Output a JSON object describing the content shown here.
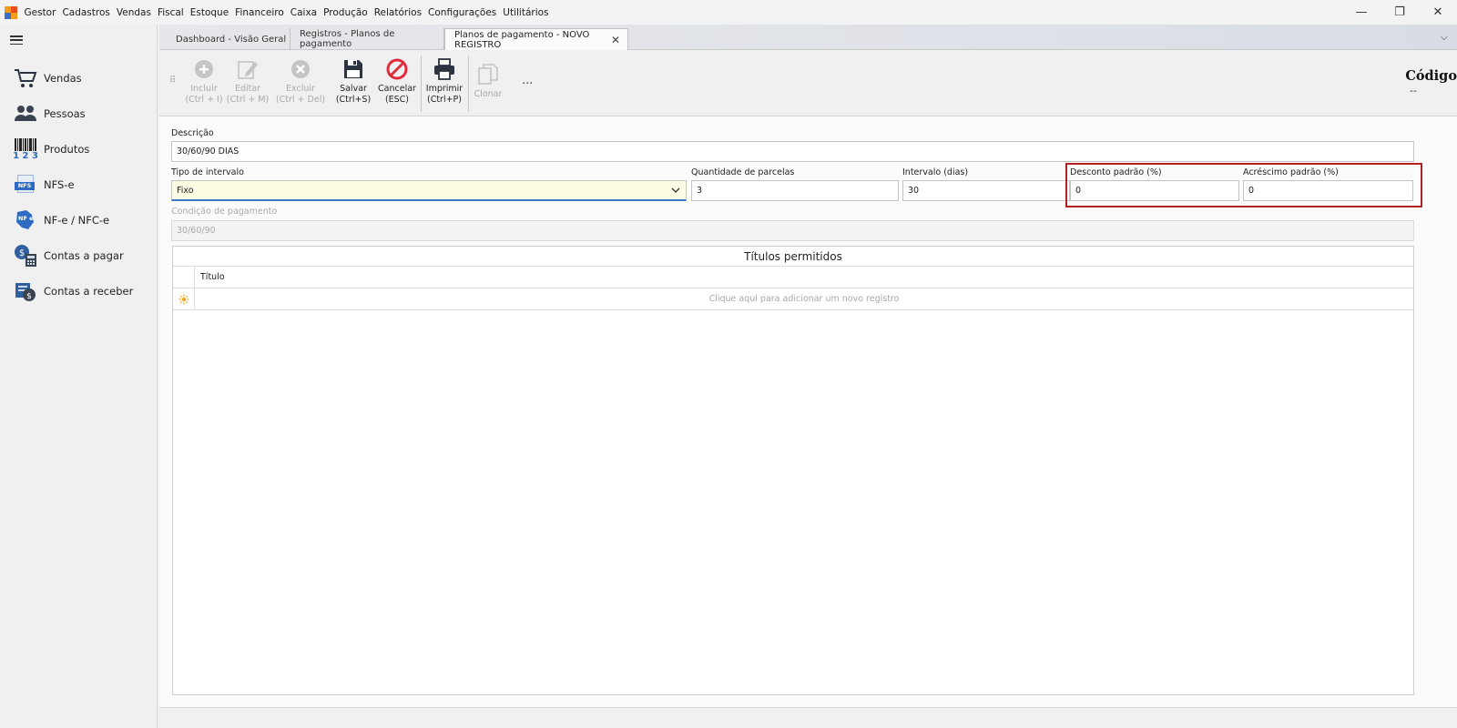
{
  "menu": {
    "items": [
      "Gestor",
      "Cadastros",
      "Vendas",
      "Fiscal",
      "Estoque",
      "Financeiro",
      "Caixa",
      "Produção",
      "Relatórios",
      "Configurações",
      "Utilitários"
    ]
  },
  "window_controls": {
    "minimize": "—",
    "restore": "❐",
    "close": "✕"
  },
  "sidebar": {
    "items": [
      {
        "label": "Vendas",
        "icon": "cart-icon"
      },
      {
        "label": "Pessoas",
        "icon": "people-icon"
      },
      {
        "label": "Produtos",
        "icon": "barcode-icon"
      },
      {
        "label": "NFS-e",
        "icon": "nfse-icon"
      },
      {
        "label": "NF-e / NFC-e",
        "icon": "nfe-icon"
      },
      {
        "label": "Contas a pagar",
        "icon": "payable-icon"
      },
      {
        "label": "Contas a receber",
        "icon": "receivable-icon"
      }
    ],
    "nfse_badge": "NFS",
    "nfe_badge": "NF e",
    "barcode_digits": "1 2 3"
  },
  "tabs": [
    {
      "label": "Dashboard - Visão Geral",
      "active": false
    },
    {
      "label": "Registros - Planos de pagamento",
      "active": false
    },
    {
      "label": "Planos de pagamento - NOVO REGISTRO",
      "active": true,
      "close": "✕"
    }
  ],
  "tab_overflow": "⌵",
  "toolbar": {
    "buttons": [
      {
        "label": "Incluir\n(Ctrl + I)",
        "enabled": false,
        "icon": "add-icon"
      },
      {
        "label": "Editar\n(Ctrl + M)",
        "enabled": false,
        "icon": "edit-icon"
      },
      {
        "label": "Excluir\n(Ctrl + Del)",
        "enabled": false,
        "icon": "delete-icon"
      },
      {
        "label": "Salvar\n(Ctrl+S)",
        "enabled": true,
        "icon": "save-icon"
      },
      {
        "label": "Cancelar\n(ESC)",
        "enabled": true,
        "icon": "cancel-icon"
      },
      {
        "label": "Imprimir\n(Ctrl+P)",
        "enabled": true,
        "icon": "print-icon"
      },
      {
        "label": "Clonar",
        "enabled": false,
        "icon": "clone-icon"
      }
    ],
    "more": "...",
    "grip": "⠿"
  },
  "header": {
    "codigo_label": "Código",
    "codigo_value": "--"
  },
  "form": {
    "descricao": {
      "label": "Descrição",
      "value": "30/60/90 DIAS"
    },
    "tipo_intervalo": {
      "label": "Tipo de intervalo",
      "value": "Fixo"
    },
    "quantidade_parcelas": {
      "label": "Quantidade de parcelas",
      "value": "3"
    },
    "intervalo_dias": {
      "label": "Intervalo (dias)",
      "value": "30"
    },
    "desconto_padrao": {
      "label": "Desconto padrão (%)",
      "value": "0"
    },
    "acrescimo_padrao": {
      "label": "Acréscimo padrão (%)",
      "value": "0"
    },
    "condicao_pagamento": {
      "label": "Condição de pagamento",
      "value": "30/60/90"
    }
  },
  "grid": {
    "title": "Títulos permitidos",
    "columns": [
      "Título"
    ],
    "new_row_hint": "Clique aqui para adicionar um novo registro"
  },
  "colors": {
    "accent_blue": "#3b78c5",
    "cancel_red": "#e02d3c",
    "highlight_red": "#b22222",
    "select_bg": "#fdfde4"
  }
}
